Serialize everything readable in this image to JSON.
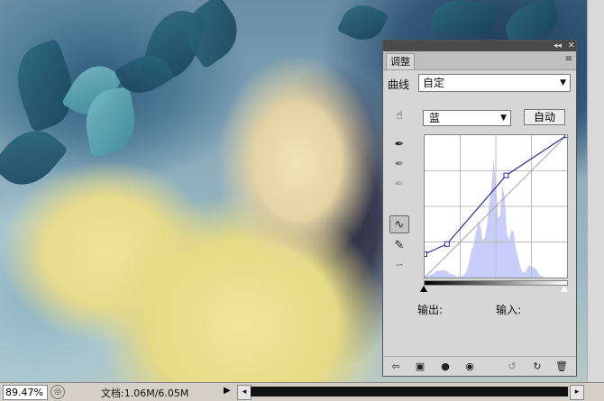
{
  "panel": {
    "tab_label": "调整",
    "topbar_collapse": "◂◂",
    "topbar_close": "✕",
    "menu_icon": "≡",
    "preset_label": "曲线",
    "preset_value": "自定",
    "channel_value": "蓝",
    "auto_label": "自动",
    "output_label": "输出:",
    "input_label": "输入:",
    "tools": {
      "target_adjust": "☝",
      "black_point": "✒",
      "gray_point": "✒",
      "white_point": "✒",
      "curve_mode": "∿",
      "pencil_mode": "✎",
      "smooth": "∽"
    },
    "bottom_buttons": {
      "back": "⇦",
      "clip": "▣",
      "visibility_mask": "●",
      "eye": "◉",
      "view_previous": "↺",
      "reset": "↻",
      "delete": "🗑"
    }
  },
  "status": {
    "zoom": "89.47%",
    "doc_label": "文档:1.06M/6.05M",
    "info_button": "◎",
    "menu_arrow": "▶",
    "scroll_left": "◂",
    "scroll_right": "▸"
  },
  "curve": {
    "channel": "blue",
    "points": [
      [
        0,
        42
      ],
      [
        40,
        60
      ],
      [
        146,
        183
      ],
      [
        255,
        255
      ]
    ],
    "histogram_color": "#c8cdfa",
    "line_color": "#2a2f9b"
  }
}
